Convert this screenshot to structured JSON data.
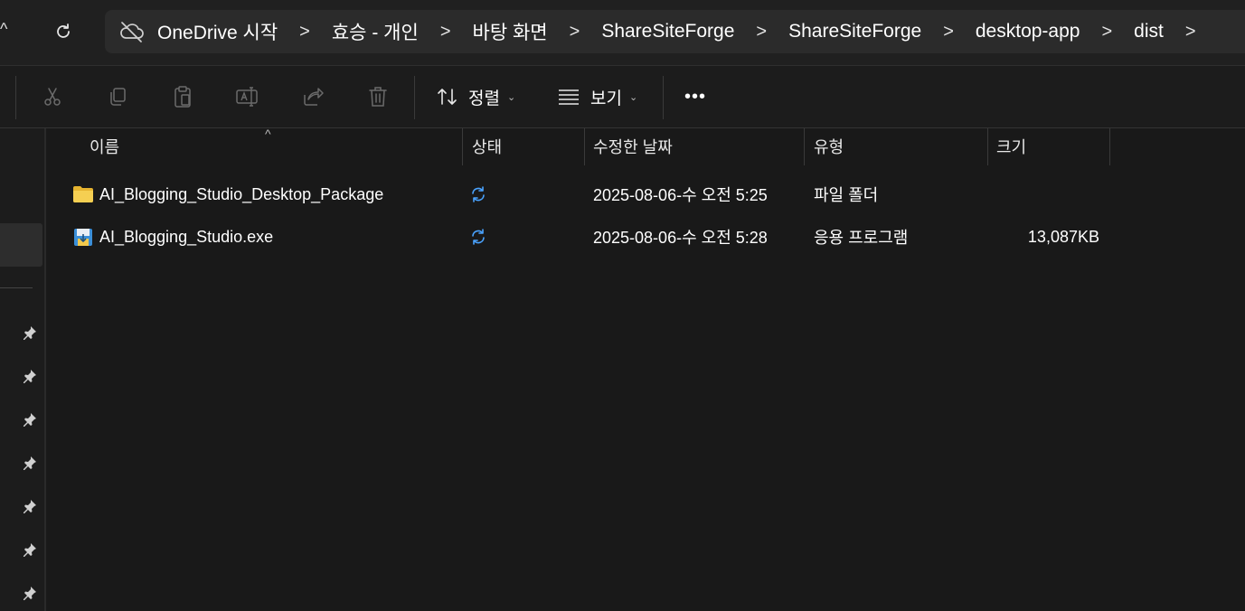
{
  "address_bar": {
    "up_glyph": "^",
    "refresh_icon": "refresh-icon",
    "location_icon": "cloud-off-icon",
    "breadcrumbs": [
      "OneDrive 시작",
      "효승 - 개인",
      "바탕 화면",
      "ShareSiteForge",
      "ShareSiteForge",
      "desktop-app",
      "dist"
    ],
    "separator": ">"
  },
  "toolbar": {
    "cut_icon": "scissors-icon",
    "copy_icon": "copy-icon",
    "paste_icon": "clipboard-icon",
    "rename_icon": "rename-icon",
    "share_icon": "share-icon",
    "delete_icon": "trash-icon",
    "sort_label": "정렬",
    "view_label": "보기",
    "more_label": "•••",
    "chevron": "⌄"
  },
  "columns": {
    "name": "이름",
    "status": "상태",
    "modified": "수정한 날짜",
    "type": "유형",
    "size": "크기",
    "sort_indicator": "^"
  },
  "files": [
    {
      "name": "AI_Blogging_Studio_Desktop_Package",
      "icon": "folder-icon",
      "status_icon": "sync-icon",
      "modified": "2025-08-06-수 오전 5:25",
      "type": "파일 폴더",
      "size": ""
    },
    {
      "name": "AI_Blogging_Studio.exe",
      "icon": "installer-icon",
      "status_icon": "sync-icon",
      "modified": "2025-08-06-수 오전 5:28",
      "type": "응용 프로그램",
      "size": "13,087KB"
    }
  ],
  "sidebar": {
    "pin_icon": "pin-icon",
    "pinned_count": 7
  },
  "colors": {
    "background": "#191919",
    "accent": "#4aa3ff",
    "folder": "#f2c94c"
  }
}
